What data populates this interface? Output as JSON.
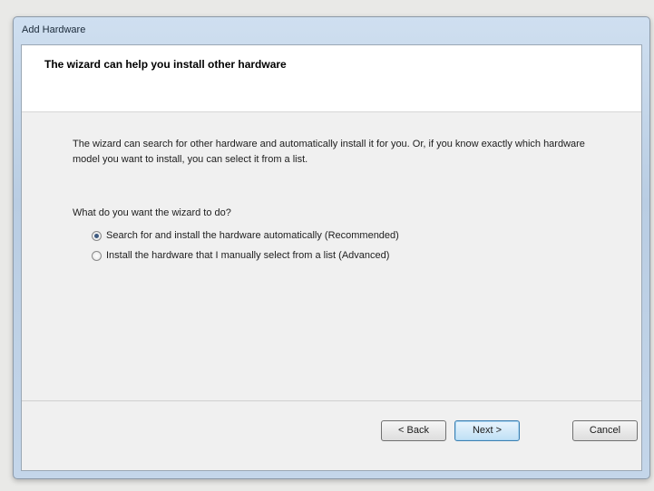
{
  "window": {
    "title": "Add Hardware"
  },
  "header": {
    "title": "The wizard can help you install other hardware"
  },
  "main": {
    "description": "The wizard can search for other hardware and automatically install it for you. Or, if you know exactly which hardware model you want to install, you can select it from a list.",
    "question": "What do you want the wizard to do?",
    "options": [
      {
        "label": "Search for and install the hardware automatically (Recommended)",
        "selected": true
      },
      {
        "label": "Install the hardware that I manually select from a list (Advanced)",
        "selected": false
      }
    ]
  },
  "footer": {
    "back_label": "< Back",
    "next_label": "Next >",
    "cancel_label": "Cancel"
  }
}
